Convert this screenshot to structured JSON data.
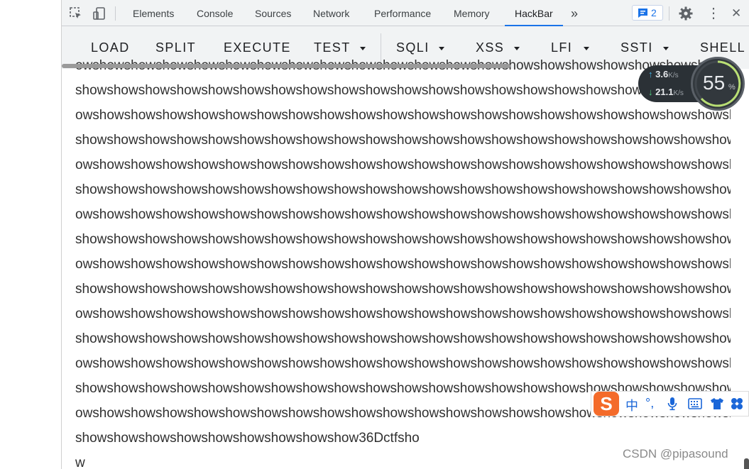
{
  "devtools": {
    "tabs": [
      {
        "label": "Elements"
      },
      {
        "label": "Console"
      },
      {
        "label": "Sources"
      },
      {
        "label": "Network"
      },
      {
        "label": "Performance"
      },
      {
        "label": "Memory"
      },
      {
        "label": "HackBar",
        "active": true
      }
    ],
    "more_tabs": "»",
    "issues_count": "2",
    "menu_glyph": "⋮",
    "close_glyph": "✕"
  },
  "hackbar": {
    "buttons": [
      "LOAD",
      "SPLIT",
      "EXECUTE",
      "TEST",
      "SQLI",
      "XSS",
      "LFI",
      "SSTI",
      "SHELL"
    ]
  },
  "page": {
    "lines": [
      "owshowshowshowshowshowshowshowshowshowshowshowshowshowshowshowshowshowshowshowshowshow",
      "showshowshowshowshowshowshowshowshowshowshowshowshowshowshowshowshowshowshowshowshowshow",
      "owshowshowshowshowshowshowshowshowshowshowshowshowshowshowshowshowshowshowshowshowshow",
      "showshowshowshowshowshowshowshowshowshowshowshowshowshowshowshowshowshowshowshowshowshow",
      "owshowshowshowshowshowshowshowshowshowshowshowshowshowshowshowshowshowshowshowshowshow",
      "showshowshowshowshowshowshowshowshowshowshowshowshowshowshowshowshowshowshowshowshowshow",
      "owshowshowshowshowshowshowshowshowshowshowshowshowshowshowshowshowshowshowshowshowshow",
      "showshowshowshowshowshowshowshowshowshowshowshowshowshowshowshowshowshowshowshowshowshow",
      "owshowshowshowshowshowshowshowshowshowshowshowshowshowshowshowshowshowshowshowshowshow",
      "showshowshowshowshowshowshowshowshowshowshowshowshowshowshowshowshowshowshowshowshowshow",
      "owshowshowshowshowshowshowshowshowshowshowshowshowshowshowshowshowshowshowshowshowshow",
      "showshowshowshowshowshowshowshowshowshowshowshowshowshowshowshowshowshowshowshowshowshow",
      "owshowshowshowshowshowshowshowshowshowshowshowshowshowshowshowshowshowshowshowshowshow",
      "showshowshowshowshowshowshowshowshowshowshowshowshowshowshowshowshowshowshowshowshowshow",
      "owshowshowshowshowshowshowshowshowshowshowshowshowshowshowshowshowshowshowshowshowshow",
      "showshowshowshowshowshowshowshowshow36Dctfsho",
      "w"
    ]
  },
  "netmon": {
    "upload": "3.6",
    "download": "21.1",
    "unit": "K/s",
    "percent": "55",
    "percent_unit": "%"
  },
  "ime": {
    "logo": "S",
    "mode": "中",
    "punct": "°,"
  },
  "watermark": "CSDN @pipasound",
  "colors": {
    "accent": "#1a73e8",
    "ime": "#f46b2a"
  }
}
